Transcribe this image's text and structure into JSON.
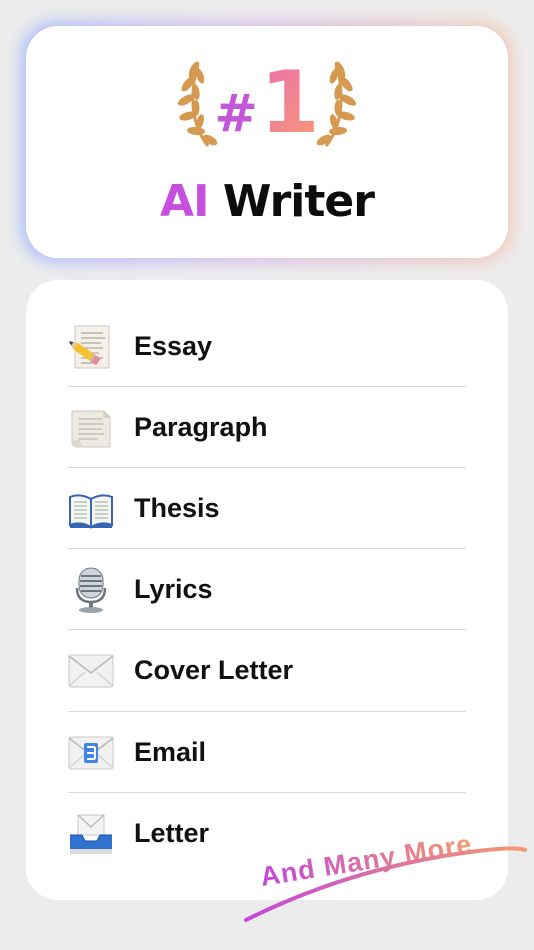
{
  "hero": {
    "rank_hash": "#",
    "rank_number": "1",
    "title_ai": "AI",
    "title_writer": "Writer",
    "colors": {
      "ai": "#c64fe0",
      "rank_gradient_start": "#ee6fb0",
      "rank_gradient_end": "#f59a72",
      "laurel": "#d59a50"
    }
  },
  "list": {
    "items": [
      {
        "label": "Essay",
        "icon": "pencil-paper-icon"
      },
      {
        "label": "Paragraph",
        "icon": "page-icon"
      },
      {
        "label": "Thesis",
        "icon": "open-book-icon"
      },
      {
        "label": "Lyrics",
        "icon": "microphone-icon"
      },
      {
        "label": "Cover Letter",
        "icon": "envelope-icon"
      },
      {
        "label": "Email",
        "icon": "email-envelope-icon"
      },
      {
        "label": "Letter",
        "icon": "inbox-tray-icon"
      }
    ]
  },
  "promo": {
    "and_many_more": "And Many More"
  }
}
